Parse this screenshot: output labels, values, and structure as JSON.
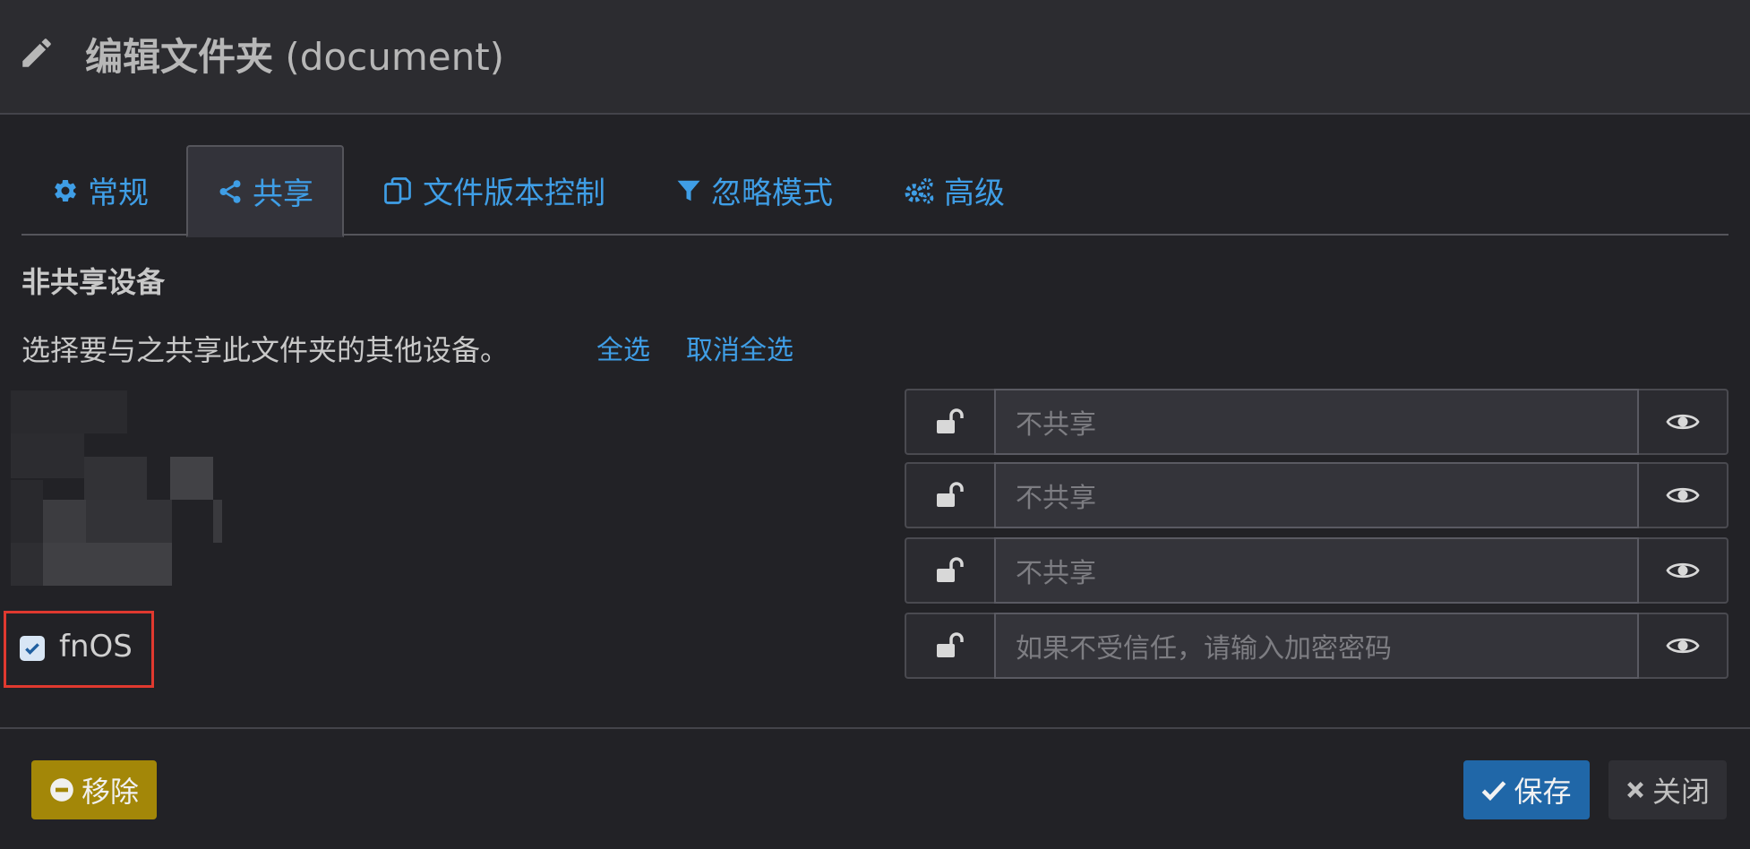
{
  "header": {
    "title_main": "编辑文件夹",
    "title_paren": " (document)"
  },
  "tabs": [
    {
      "label": "常规",
      "icon": "gear-icon"
    },
    {
      "label": "共享",
      "icon": "share-icon",
      "active": true
    },
    {
      "label": "文件版本控制",
      "icon": "copy-icon"
    },
    {
      "label": "忽略模式",
      "icon": "filter-icon"
    },
    {
      "label": "高级",
      "icon": "gears-icon"
    }
  ],
  "section": {
    "title": "非共享设备",
    "description": "选择要与之共享此文件夹的其他设备。",
    "select_all": "全选",
    "deselect_all": "取消全选"
  },
  "device": {
    "name": "fnOS",
    "checked": true
  },
  "password_rows": [
    {
      "placeholder": "不共享"
    },
    {
      "placeholder": "不共享"
    },
    {
      "placeholder": "不共享"
    },
    {
      "placeholder": "如果不受信任，请输入加密密码"
    }
  ],
  "footer": {
    "remove_label": "移除",
    "save_label": "保存",
    "close_label": "关闭"
  },
  "colors": {
    "accent": "#3f9ee6",
    "save": "#2067a8",
    "remove": "#a38708",
    "highlight": "#e0392f"
  }
}
